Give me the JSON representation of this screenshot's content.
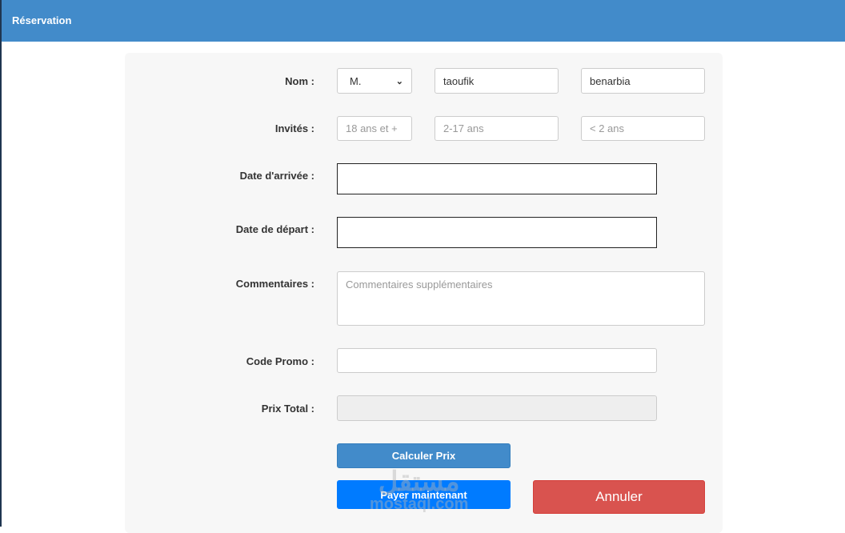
{
  "header": {
    "title": "Réservation"
  },
  "form": {
    "nom_label": "Nom :",
    "civilite": "M.",
    "prenom": "taoufik",
    "nom": "benarbia",
    "invites_label": "Invités :",
    "adults_placeholder": "18 ans et +",
    "children_placeholder": "2-17 ans",
    "infants_placeholder": "< 2 ans",
    "arrivee_label": "Date d'arrivée :",
    "depart_label": "Date de départ :",
    "commentaires_label": "Commentaires :",
    "commentaires_placeholder": "Commentaires supplémentaires",
    "promo_label": "Code Promo :",
    "prix_label": "Prix Total :"
  },
  "buttons": {
    "calculer": "Calculer Prix",
    "payer": "Payer maintenant",
    "annuler": "Annuler"
  },
  "colors": {
    "header": "#428bca",
    "calculer": "#428bca",
    "payer": "#007bff",
    "annuler": "#d9534f"
  },
  "watermark": {
    "arabic": "مستقل",
    "latin": "mostaql.com"
  }
}
